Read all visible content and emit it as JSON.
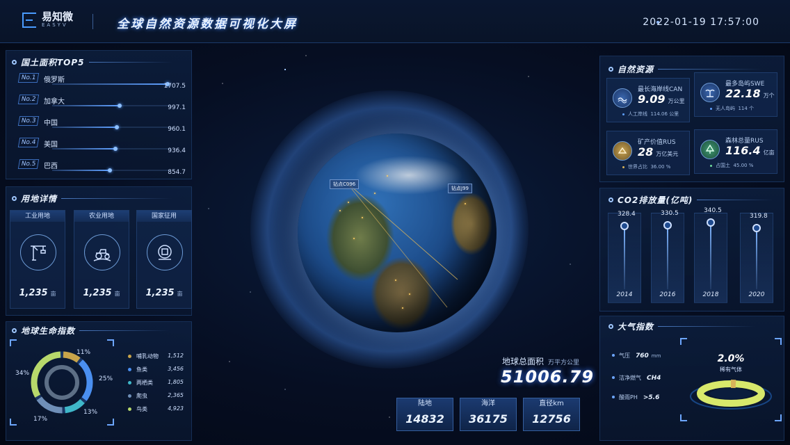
{
  "header": {
    "brand_cn": "易知微",
    "brand_en": "EASYV",
    "title": "全球自然资源数据可视化大屏",
    "datetime": "2022-01-19 17:57:00"
  },
  "top5": {
    "title": "国土面积TOP5",
    "items": [
      {
        "rank": "No.1",
        "name": "俄罗斯",
        "value": "1707.5",
        "fraction": 1.0
      },
      {
        "rank": "No.2",
        "name": "加拿大",
        "value": "997.1",
        "fraction": 0.584
      },
      {
        "rank": "No.3",
        "name": "中国",
        "value": "960.1",
        "fraction": 0.562
      },
      {
        "rank": "No.4",
        "name": "美国",
        "value": "936.4",
        "fraction": 0.548
      },
      {
        "rank": "No.5",
        "name": "巴西",
        "value": "854.7",
        "fraction": 0.5
      }
    ]
  },
  "land_use": {
    "title": "用地详情",
    "cards": [
      {
        "label": "工业用地",
        "value": "1,235",
        "unit": "亩",
        "icon": "crane-icon"
      },
      {
        "label": "农业用地",
        "value": "1,235",
        "unit": "亩",
        "icon": "tractor-icon"
      },
      {
        "label": "国家征用",
        "value": "1,235",
        "unit": "亩",
        "icon": "government-icon"
      }
    ]
  },
  "life_index": {
    "title": "地球生命指数",
    "percent_labels": [
      "11%",
      "25%",
      "13%",
      "17%",
      "34%"
    ],
    "items": [
      {
        "name": "哺乳动物",
        "value": "1,512",
        "color": "#c8a44a"
      },
      {
        "name": "鱼类",
        "value": "3,456",
        "color": "#4a8ff0"
      },
      {
        "name": "两栖类",
        "value": "1,805",
        "color": "#3fb7c9"
      },
      {
        "name": "爬虫",
        "value": "2,365",
        "color": "#6f8fb8"
      },
      {
        "name": "鸟类",
        "value": "4,923",
        "color": "#b7d86b"
      }
    ],
    "shares": [
      0.11,
      0.25,
      0.13,
      0.17,
      0.34
    ]
  },
  "earth": {
    "markers": [
      "钻点C096",
      "钻点J99"
    ],
    "total_label": "地球总面积",
    "total_unit": "万平方公里",
    "total_value": "51006.79",
    "stats": [
      {
        "label": "陆地",
        "value": "14832"
      },
      {
        "label": "海洋",
        "value": "36175"
      },
      {
        "label": "直径km",
        "value": "12756"
      }
    ]
  },
  "resources": {
    "title": "自然资源",
    "cards": [
      {
        "label": "最长海岸线CAN",
        "value": "9.09",
        "unit": "万公里",
        "sub_label": "人工岸线",
        "sub_value": "114.06",
        "sub_unit": "公里",
        "icon": "coastline-icon"
      },
      {
        "label": "最多岛屿SWE",
        "value": "22.18",
        "unit": "万个",
        "sub_label": "无人岛屿",
        "sub_value": "114",
        "sub_unit": "个",
        "icon": "island-icon"
      },
      {
        "label": "矿产价值RUS",
        "value": "28",
        "unit": "万亿美元",
        "sub_label": "世界占比",
        "sub_value": "36.00",
        "sub_unit": "%",
        "icon": "mineral-icon"
      },
      {
        "label": "森林总量RUS",
        "value": "116.4",
        "unit": "亿亩",
        "sub_label": "占国土",
        "sub_value": "45.00",
        "sub_unit": "%",
        "icon": "forest-icon"
      }
    ]
  },
  "co2": {
    "title": "CO2排放量(亿吨)",
    "years": [
      "2014",
      "2016",
      "2018",
      "2020"
    ],
    "values": [
      "328.4",
      "330.5",
      "340.5",
      "319.8"
    ]
  },
  "atmosphere": {
    "title": "大气指数",
    "rows": [
      {
        "label": "气压",
        "value": "760",
        "unit": "mm"
      },
      {
        "label": "洁净燃气",
        "value": "CH4",
        "unit": ""
      },
      {
        "label": "酸雨PH",
        "value": ">5.6",
        "unit": ""
      }
    ],
    "rare_gas_percent": "2.0%",
    "rare_gas_label": "稀有气体"
  },
  "colors": {
    "accent": "#5fa0ff",
    "background": "#060e22",
    "panel": "#0e2142",
    "gold": "#d8b35a"
  }
}
